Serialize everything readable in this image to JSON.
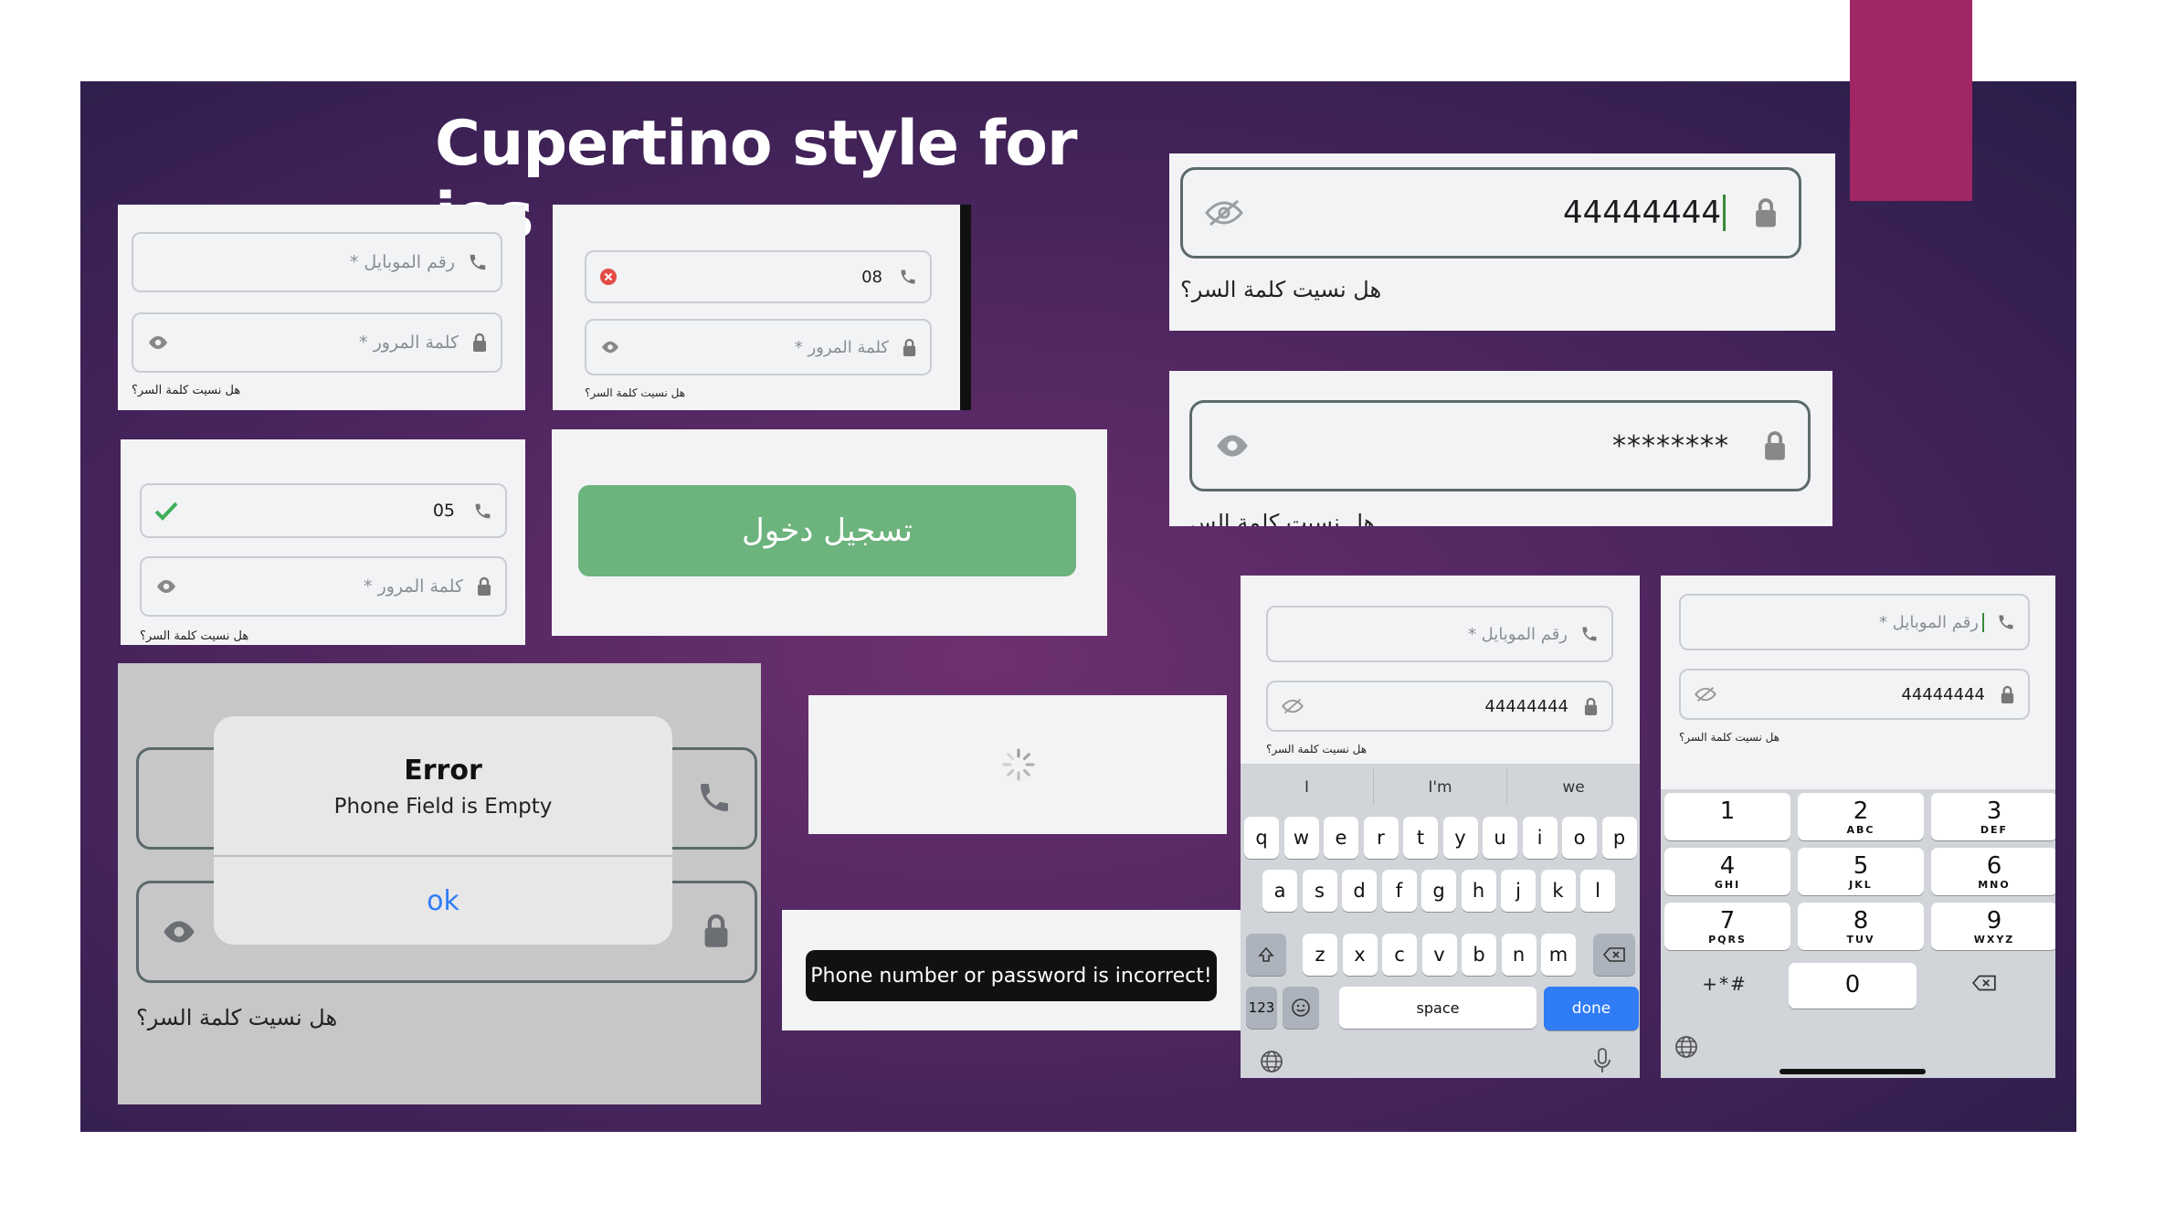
{
  "slide": {
    "title": "Cupertino style for ios",
    "background_color": "#4e2660",
    "accent_color": "#a02764"
  },
  "login": {
    "phone_placeholder": "* رقم الموبايل",
    "password_placeholder": "* كلمة المرور",
    "forgot_password": "هل نسيت كلمة السر؟",
    "login_button": "تسجيل دخول",
    "login_button_color": "#6cb37d"
  },
  "panel_invalid": {
    "phone_value": "08",
    "status": "error-icon"
  },
  "panel_valid": {
    "phone_value": "05",
    "status": "check-icon"
  },
  "panel_password_visible": {
    "password_value": "44444444"
  },
  "panel_password_hidden": {
    "password_value": "********",
    "forgot_password_partial": "هل نسيت كلمة الس"
  },
  "alert": {
    "title": "Error",
    "message": "Phone Field is Empty",
    "ok_label": "ok",
    "masked": "•••"
  },
  "toast": {
    "message": "Phone number or password is incorrect!"
  },
  "keyboard": {
    "password_value": "44444444",
    "suggestions": [
      "I",
      "I'm",
      "we"
    ],
    "row1": [
      "q",
      "w",
      "e",
      "r",
      "t",
      "y",
      "u",
      "i",
      "o",
      "p"
    ],
    "row2": [
      "a",
      "s",
      "d",
      "f",
      "g",
      "h",
      "j",
      "k",
      "l"
    ],
    "row3": [
      "z",
      "x",
      "c",
      "v",
      "b",
      "n",
      "m"
    ],
    "numbers_label": "123",
    "space_label": "space",
    "done_label": "done",
    "done_color": "#2f7cf6"
  },
  "numpad": {
    "password_value": "44444444",
    "keys": [
      {
        "digit": "1",
        "letters": ""
      },
      {
        "digit": "2",
        "letters": "ABC"
      },
      {
        "digit": "3",
        "letters": "DEF"
      },
      {
        "digit": "4",
        "letters": "GHI"
      },
      {
        "digit": "5",
        "letters": "JKL"
      },
      {
        "digit": "6",
        "letters": "MNO"
      },
      {
        "digit": "7",
        "letters": "PQRS"
      },
      {
        "digit": "8",
        "letters": "TUV"
      },
      {
        "digit": "9",
        "letters": "WXYZ"
      }
    ],
    "symbols": "+*#",
    "zero": "0"
  }
}
